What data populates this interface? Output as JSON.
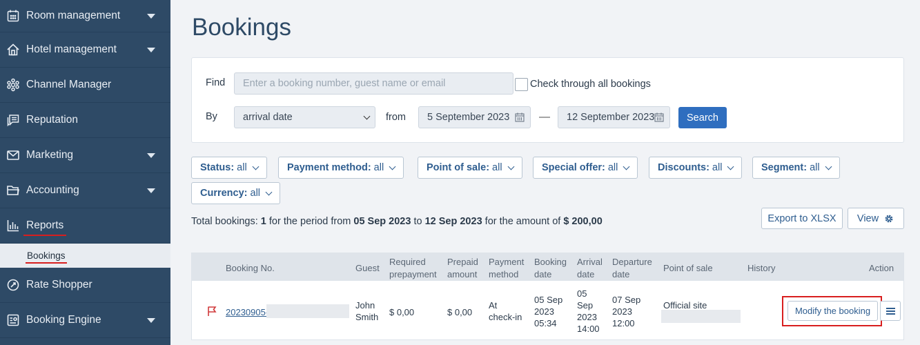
{
  "sidebar": {
    "items": [
      {
        "label": "Room management",
        "icon": "calendar-icon",
        "has_caret": true
      },
      {
        "label": "Hotel management",
        "icon": "home-icon",
        "has_caret": true
      },
      {
        "label": "Channel Manager",
        "icon": "network-icon",
        "has_caret": false
      },
      {
        "label": "Reputation",
        "icon": "chat-icon",
        "has_caret": false
      },
      {
        "label": "Marketing",
        "icon": "mail-icon",
        "has_caret": true
      },
      {
        "label": "Accounting",
        "icon": "folder-icon",
        "has_caret": true
      },
      {
        "label": "Reports",
        "icon": "bar-chart-icon",
        "has_caret": false
      },
      {
        "label": "Rate Shopper",
        "icon": "rate-icon",
        "has_caret": false
      },
      {
        "label": "Booking Engine",
        "icon": "booking-engine-icon",
        "has_caret": true
      }
    ],
    "subitem": "Bookings"
  },
  "page": {
    "title": "Bookings"
  },
  "find": {
    "find_label": "Find",
    "search_placeholder": "Enter a booking number, guest name or email",
    "check_all_label": "Check through all bookings",
    "by_label": "By",
    "by_value": "arrival date",
    "from_label": "from",
    "date_from": "5 September 2023",
    "dash": "—",
    "date_to": "12 September 2023",
    "search_button": "Search"
  },
  "filters": [
    {
      "key": "Status:",
      "value": "all"
    },
    {
      "key": "Payment method:",
      "value": "all"
    },
    {
      "key": "Point of sale:",
      "value": "all"
    },
    {
      "key": "Special offer:",
      "value": "all"
    },
    {
      "key": "Discounts:",
      "value": "all"
    },
    {
      "key": "Segment:",
      "value": "all"
    },
    {
      "key": "Currency:",
      "value": "all"
    }
  ],
  "summary": {
    "t1": "Total bookings:",
    "count": "1",
    "t2": "for the period from",
    "from": "05 Sep 2023",
    "t3": "to",
    "to": "12 Sep 2023",
    "t4": "for the amount of",
    "amount": "$ 200,00"
  },
  "actions": {
    "export": "Export to XLSX",
    "view": "View"
  },
  "table": {
    "headers": {
      "booking_no": "Booking No.",
      "guest": "Guest",
      "required_prepayment": [
        "Required",
        "prepayment"
      ],
      "prepaid_amount": [
        "Prepaid",
        "amount"
      ],
      "payment_method": [
        "Payment",
        "method"
      ],
      "booking_date": [
        "Booking",
        "date"
      ],
      "arrival_date": [
        "Arrival",
        "date"
      ],
      "departure_date": [
        "Departure",
        "date"
      ],
      "point_of_sale": "Point of sale",
      "history": "History",
      "action": "Action"
    },
    "row": {
      "booking_no": "20230905-",
      "guest": [
        "John",
        "Smith"
      ],
      "required_prepayment": "$ 0,00",
      "prepaid_amount": "$ 0,00",
      "payment_method": [
        "At",
        "check-in"
      ],
      "booking_date": [
        "05 Sep",
        "2023",
        "05:34"
      ],
      "arrival_date": [
        "05",
        "Sep",
        "2023",
        "14:00"
      ],
      "departure_date": [
        "07 Sep",
        "2023",
        "12:00"
      ],
      "point_of_sale": "Official site",
      "modify_button": "Modify the booking"
    }
  },
  "colors": {
    "sidebar": "#2e4a66",
    "accent": "#2f6ebf",
    "highlight": "#d81e1e",
    "flag": "#d0393a"
  }
}
